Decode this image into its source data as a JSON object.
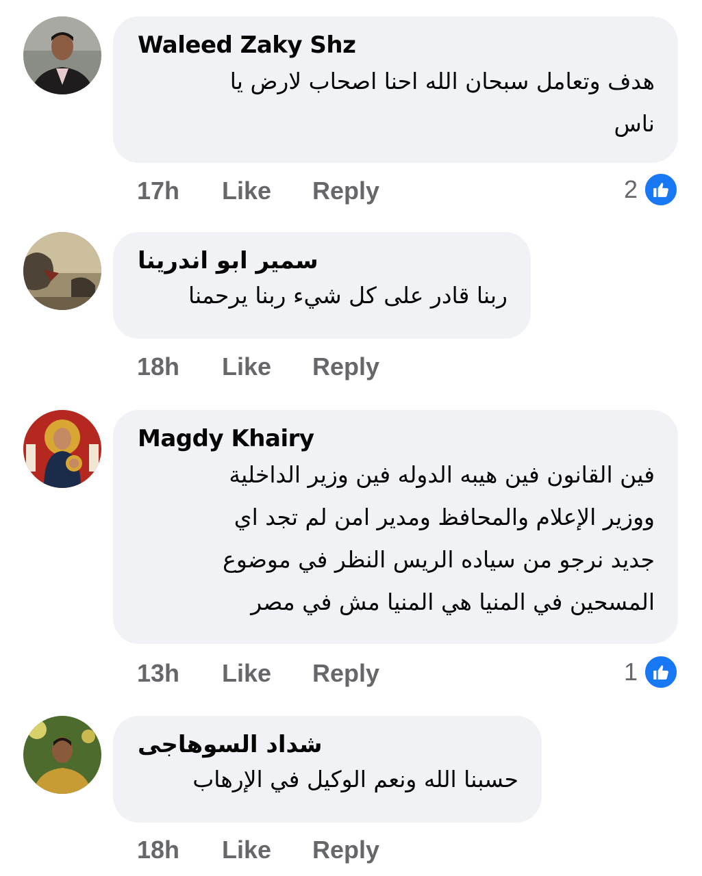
{
  "comments": [
    {
      "author": "Waleed Zaky Shz",
      "text": "هدف وتعامل سبحان الله احنا اصحاب لارض يا\nناس",
      "time": "17h",
      "like_label": "Like",
      "reply_label": "Reply",
      "reaction_count": "2",
      "avatar_icon": "user-photo-icon"
    },
    {
      "author": "سمير ابو اندرينا",
      "text": "ربنا قادر على كل شيء ربنا يرحمنا",
      "time": "18h",
      "like_label": "Like",
      "reply_label": "Reply",
      "avatar_icon": "lion-artwork-icon"
    },
    {
      "author": "Magdy Khairy",
      "text": "فين القانون فين هيبه الدوله فين وزير الداخلية\nووزير الإعلام والمحافظ ومدير امن لم تجد اي\nجديد نرجو من سياده الريس النظر في موضوع\nالمسحين  في المنيا هي المنيا مش في مصر",
      "time": "13h",
      "like_label": "Like",
      "reply_label": "Reply",
      "reaction_count": "1",
      "avatar_icon": "religious-icon-avatar"
    },
    {
      "author": "شداد السوهاجى",
      "text": "حسبنا الله ونعم الوكيل في الإرهاب",
      "time": "18h",
      "like_label": "Like",
      "reply_label": "Reply",
      "avatar_icon": "user-photo-icon"
    }
  ],
  "colors": {
    "bubble": "#f0f2f5",
    "meta": "#65676b",
    "like_blue": "#1877f2"
  }
}
